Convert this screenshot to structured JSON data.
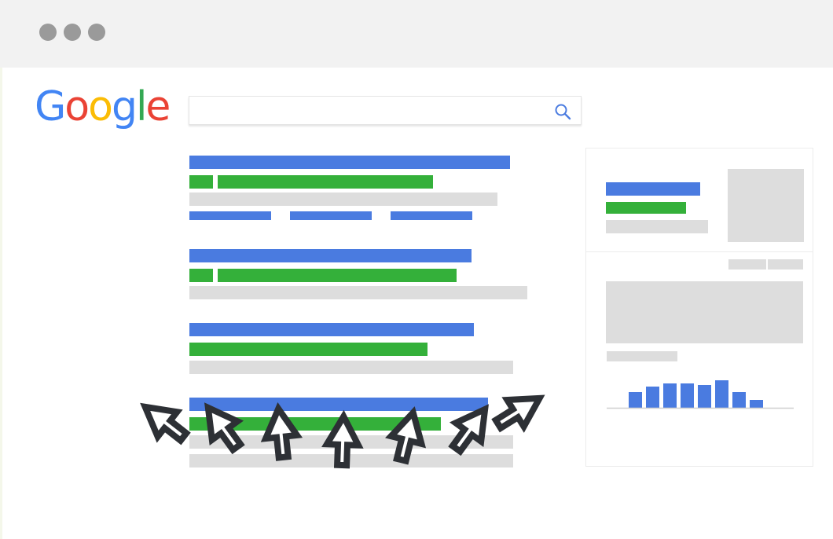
{
  "window": {
    "controls": [
      "dot",
      "dot",
      "dot"
    ]
  },
  "logo": {
    "letters": [
      {
        "char": "G",
        "color": "#4285F4"
      },
      {
        "char": "o",
        "color": "#EA4335"
      },
      {
        "char": "o",
        "color": "#FBBC05"
      },
      {
        "char": "g",
        "color": "#4285F4"
      },
      {
        "char": "l",
        "color": "#34A853"
      },
      {
        "char": "e",
        "color": "#EA4335"
      }
    ]
  },
  "search": {
    "value": "",
    "icon": "search-icon"
  },
  "colors": {
    "accent_blue": "#4a7be0",
    "accent_green": "#34b03a",
    "placeholder_grey": "#dddddd",
    "cursor": "#2d3035"
  },
  "cursor_icon": "arrow-cursor-icon"
}
